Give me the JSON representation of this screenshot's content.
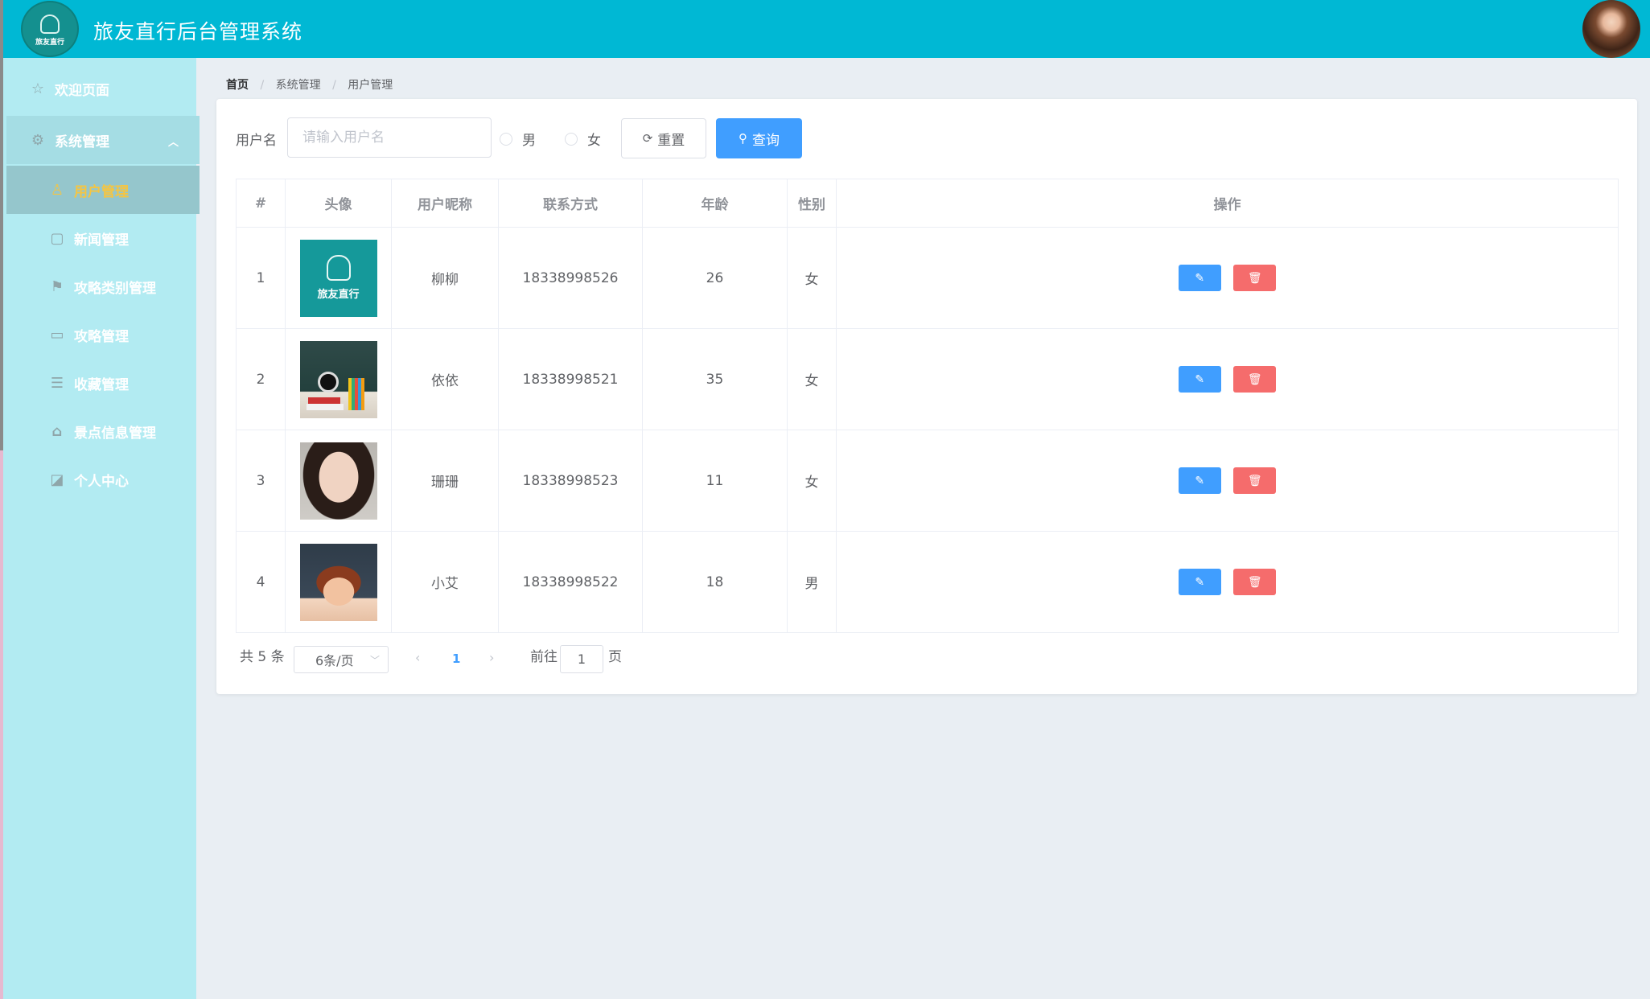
{
  "header": {
    "title": "旅友直行后台管理系统",
    "logo_text": "旅友直行"
  },
  "sidebar": {
    "items": [
      {
        "label": "欢迎页面",
        "icon": "star-icon"
      },
      {
        "label": "系统管理",
        "icon": "gear-icon",
        "expanded": true
      },
      {
        "label": "用户管理",
        "icon": "user-icon",
        "active": true
      },
      {
        "label": "新闻管理",
        "icon": "document-icon"
      },
      {
        "label": "攻略类别管理",
        "icon": "flag-icon"
      },
      {
        "label": "攻略管理",
        "icon": "card-icon"
      },
      {
        "label": "收藏管理",
        "icon": "bookmark-icon"
      },
      {
        "label": "景点信息管理",
        "icon": "home-icon"
      },
      {
        "label": "个人中心",
        "icon": "profile-icon"
      }
    ]
  },
  "breadcrumb": [
    "首页",
    "系统管理",
    "用户管理"
  ],
  "search": {
    "label": "用户名",
    "placeholder": "请输入用户名",
    "value": "",
    "gender_male": "男",
    "gender_female": "女",
    "reset_label": "重置",
    "query_label": "查询"
  },
  "table": {
    "headers": [
      "#",
      "头像",
      "用户昵称",
      "联系方式",
      "年龄",
      "性别",
      "操作"
    ],
    "rows": [
      {
        "index": "1",
        "avatar": "logo",
        "nickname": "柳柳",
        "phone": "18338998526",
        "age": "26",
        "gender": "女"
      },
      {
        "index": "2",
        "avatar": "clock",
        "nickname": "依依",
        "phone": "18338998521",
        "age": "35",
        "gender": "女"
      },
      {
        "index": "3",
        "avatar": "woman",
        "nickname": "珊珊",
        "phone": "18338998523",
        "age": "11",
        "gender": "女"
      },
      {
        "index": "4",
        "avatar": "kid",
        "nickname": "小艾",
        "phone": "18338998522",
        "age": "18",
        "gender": "男"
      }
    ]
  },
  "pagination": {
    "total_text": "共 5 条",
    "page_size": "6条/页",
    "current_page": "1",
    "goto_label": "前往",
    "goto_value": "1",
    "page_suffix": "页"
  },
  "colors": {
    "header_bg": "#00b8d4",
    "sidebar_bg": "#b2ebf2",
    "active_text": "#f5c542",
    "primary": "#409eff",
    "danger": "#f56c6c"
  }
}
